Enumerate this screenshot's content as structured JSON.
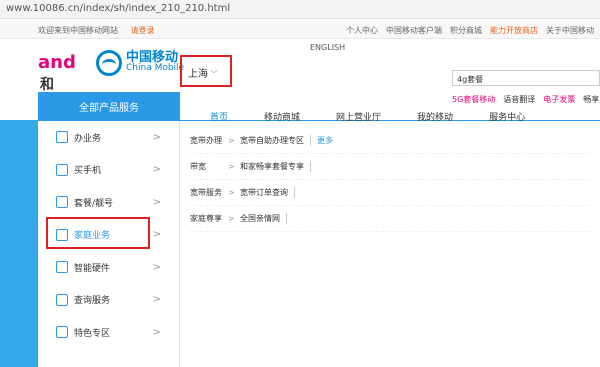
{
  "browser": {
    "url": "www.10086.cn/index/sh/index_210_210.html"
  },
  "topnav": {
    "welcome": "欢迎来到中国移动网站",
    "login": "请登录",
    "links": [
      "个人中心",
      "中国移动客户端",
      "积分商城",
      "能力开放商店",
      "关于中国移动"
    ]
  },
  "english": "ENGLISH",
  "logo": {
    "and": "and",
    "he": "和",
    "cn": "中国移动",
    "en": "China Mobile"
  },
  "city": {
    "name": "上海"
  },
  "search": {
    "value": "4g套餐"
  },
  "hotwords": [
    "5G套餐移动",
    "语音翻译",
    "电子发票",
    "畅享"
  ],
  "all_products": "全部产品服务",
  "mainnav": [
    "首页",
    "移动商城",
    "网上营业厅",
    "我的移动",
    "服务中心"
  ],
  "sidebar": [
    {
      "label": "办业务",
      "icon": "briefcase-icon"
    },
    {
      "label": "买手机",
      "icon": "phone-icon"
    },
    {
      "label": "套餐/靓号",
      "icon": "sim-icon"
    },
    {
      "label": "家庭业务",
      "icon": "sofa-icon"
    },
    {
      "label": "智能硬件",
      "icon": "device-icon"
    },
    {
      "label": "查询服务",
      "icon": "user-search-icon"
    },
    {
      "label": "特色专区",
      "icon": "special-icon"
    }
  ],
  "panel": {
    "rows": [
      {
        "label": "宽带办理",
        "links": [
          "宽带自助办理专区"
        ],
        "more": "更多"
      },
      {
        "label": "带宽",
        "links": [
          "和家畅享套餐专享"
        ]
      },
      {
        "label": "宽带服务",
        "links": [
          "宽带订单查询"
        ]
      },
      {
        "label": "家庭尊享",
        "links": [
          "全国亲情网"
        ]
      }
    ]
  }
}
